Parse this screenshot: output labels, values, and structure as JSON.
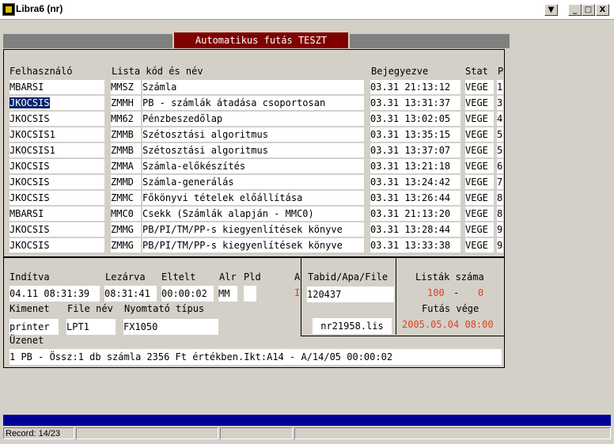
{
  "window": {
    "title": "Libra6 (nr)",
    "btn_down": "▼",
    "btn_min": "_",
    "btn_max": "□",
    "btn_close": "X"
  },
  "banner": {
    "title": "Automatikus futás  TESZT"
  },
  "table": {
    "headers": {
      "user": "Felhasználó",
      "list": "Lista kód és név",
      "time": "Bejegyezve",
      "stat": "Stat",
      "p": "P"
    },
    "rows": [
      {
        "user": "MBARSI",
        "code": "MMSZ",
        "name": "Számla",
        "time": "03.31 21:13:12",
        "stat": "VEGE",
        "p": "1"
      },
      {
        "user": "JKOCSIS",
        "code": "ZMMH",
        "name": "PB - számlák átadása csoportosan",
        "time": "03.31 13:31:37",
        "stat": "VEGE",
        "p": "3"
      },
      {
        "user": "JKOCSIS",
        "code": "MM62",
        "name": "Pénzbeszedőlap",
        "time": "03.31 13:02:05",
        "stat": "VEGE",
        "p": "4"
      },
      {
        "user": "JKOCSIS1",
        "code": "ZMMB",
        "name": "Szétosztási algoritmus",
        "time": "03.31 13:35:15",
        "stat": "VEGE",
        "p": "5"
      },
      {
        "user": "JKOCSIS1",
        "code": "ZMMB",
        "name": "Szétosztási algoritmus",
        "time": "03.31 13:37:07",
        "stat": "VEGE",
        "p": "5"
      },
      {
        "user": "JKOCSIS",
        "code": "ZMMA",
        "name": "Számla-előkészítés",
        "time": "03.31 13:21:18",
        "stat": "VEGE",
        "p": "6"
      },
      {
        "user": "JKOCSIS",
        "code": "ZMMD",
        "name": "Számla-generálás",
        "time": "03.31 13:24:42",
        "stat": "VEGE",
        "p": "7"
      },
      {
        "user": "JKOCSIS",
        "code": "ZMMC",
        "name": "Főkönyvi tételek előállítása",
        "time": "03.31 13:26:44",
        "stat": "VEGE",
        "p": "8"
      },
      {
        "user": "MBARSI",
        "code": "MMC0",
        "name": "Csekk (Számlák alapján - MMC0)",
        "time": "03.31 21:13:20",
        "stat": "VEGE",
        "p": "8"
      },
      {
        "user": "JKOCSIS",
        "code": "ZMMG",
        "name": "PB/PI/TM/PP-s kiegyenlítések könyve",
        "time": "03.31 13:28:44",
        "stat": "VEGE",
        "p": "9"
      },
      {
        "user": "JKOCSIS",
        "code": "ZMMG",
        "name": "PB/PI/TM/PP-s kiegyenlítések könyve",
        "time": "03.31 13:33:38",
        "stat": "VEGE",
        "p": "9"
      }
    ]
  },
  "details": {
    "inditva_label": "Indítva",
    "inditva": "04.11 08:31:39",
    "lezarva_label": "Lezárva",
    "lezarva": "08:31:41",
    "eltelt_label": "Eltelt",
    "eltelt": "00:00:02",
    "alr_label": "Alr",
    "alr": "MM",
    "pld_label": "Pld",
    "pld": "",
    "a_label": "A",
    "a_value": "I",
    "kimenet_label": "Kimenet",
    "kimenet": "printer",
    "filenev_label": "File név",
    "filenev": "LPT1",
    "nyomtato_label": "Nyomtató típus",
    "nyomtato": "FX1050",
    "uzenet_label": "Üzenet",
    "uzenet": "1 PB - Össz:1 db számla 2356 Ft értékben.Ikt:A14 - A/14/05 00:00:02",
    "tabid_label": "Tabid/Apa/File",
    "tabid": "120437",
    "file": "nr21958.lis",
    "listak_label": "Listák száma",
    "listak_a": "100",
    "listak_sep": "-",
    "listak_b": "0",
    "futasvege_label": "Futás vége",
    "futasvege": "2005.05.04 08:00"
  },
  "status": {
    "record": "Record: 14/23"
  },
  "colors": {
    "banner": "#800000",
    "selection": "#0a246a",
    "accent_text": "#e04020",
    "bottom_bar": "#000099"
  }
}
